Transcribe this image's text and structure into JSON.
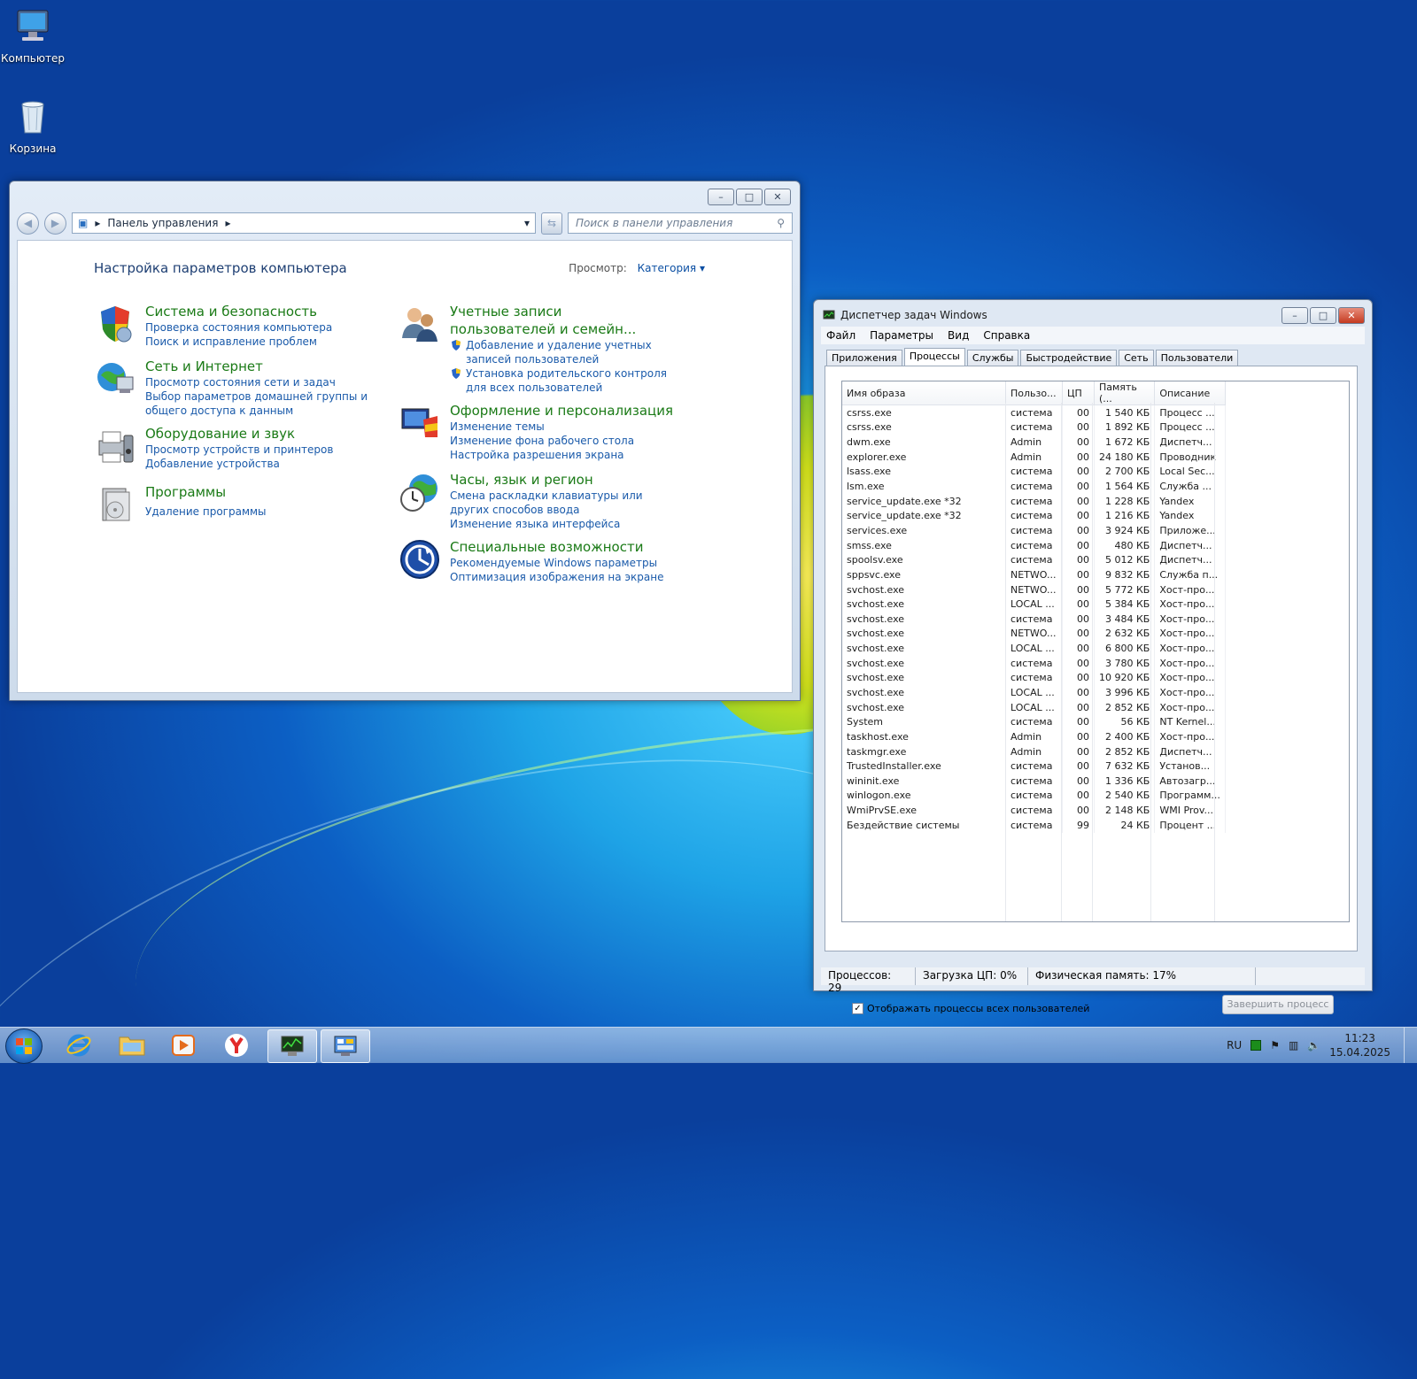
{
  "desktop": {
    "icons": [
      {
        "label": "Компьютер",
        "icon": "computer-icon"
      },
      {
        "label": "Корзина",
        "icon": "recycle-bin-icon"
      }
    ]
  },
  "control_panel": {
    "breadcrumb": "Панель управления",
    "search_placeholder": "Поиск в панели управления",
    "heading": "Настройка параметров компьютера",
    "view_label": "Просмотр:",
    "view_value": "Категория",
    "categories": [
      {
        "title": "Система и безопасность",
        "icon": "shield-icon",
        "links": [
          "Проверка состояния компьютера",
          "Поиск и исправление проблем"
        ]
      },
      {
        "title": "Сеть и Интернет",
        "icon": "network-icon",
        "links": [
          "Просмотр состояния сети и задач",
          "Выбор параметров домашней группы и общего доступа к данным"
        ]
      },
      {
        "title": "Оборудование и звук",
        "icon": "printer-icon",
        "links": [
          "Просмотр устройств и принтеров",
          "Добавление устройства"
        ]
      },
      {
        "title": "Программы",
        "icon": "programs-icon",
        "links": [
          "Удаление программы"
        ]
      },
      {
        "title": "Учетные записи пользователей и семейн...",
        "icon": "users-icon",
        "links": [
          "Добавление и удаление учетных записей пользователей",
          "Установка родительского контроля для всех пользователей"
        ]
      },
      {
        "title": "Оформление и персонализация",
        "icon": "appearance-icon",
        "links": [
          "Изменение темы",
          "Изменение фона рабочего стола",
          "Настройка разрешения экрана"
        ]
      },
      {
        "title": "Часы, язык и регион",
        "icon": "clock-globe-icon",
        "links": [
          "Смена раскладки клавиатуры или других способов ввода",
          "Изменение языка интерфейса"
        ]
      },
      {
        "title": "Специальные возможности",
        "icon": "accessibility-icon",
        "links": [
          "Рекомендуемые Windows параметры",
          "Оптимизация изображения на экране"
        ]
      }
    ]
  },
  "task_manager": {
    "title": "Диспетчер задач Windows",
    "menu": [
      "Файл",
      "Параметры",
      "Вид",
      "Справка"
    ],
    "tabs": [
      "Приложения",
      "Процессы",
      "Службы",
      "Быстродействие",
      "Сеть",
      "Пользователи"
    ],
    "active_tab": "Процессы",
    "columns": [
      "Имя образа",
      "Пользо...",
      "ЦП",
      "Память (...",
      "Описание"
    ],
    "rows": [
      [
        "csrss.exe",
        "система",
        "00",
        "1 540 КБ",
        "Процесс ..."
      ],
      [
        "csrss.exe",
        "система",
        "00",
        "1 892 КБ",
        "Процесс ..."
      ],
      [
        "dwm.exe",
        "Admin",
        "00",
        "1 672 КБ",
        "Диспетч..."
      ],
      [
        "explorer.exe",
        "Admin",
        "00",
        "24 180 КБ",
        "Проводник"
      ],
      [
        "lsass.exe",
        "система",
        "00",
        "2 700 КБ",
        "Local Sec..."
      ],
      [
        "lsm.exe",
        "система",
        "00",
        "1 564 КБ",
        "Служба ..."
      ],
      [
        "service_update.exe *32",
        "система",
        "00",
        "1 228 КБ",
        "Yandex"
      ],
      [
        "service_update.exe *32",
        "система",
        "00",
        "1 216 КБ",
        "Yandex"
      ],
      [
        "services.exe",
        "система",
        "00",
        "3 924 КБ",
        "Приложе..."
      ],
      [
        "smss.exe",
        "система",
        "00",
        "480 КБ",
        "Диспетч..."
      ],
      [
        "spoolsv.exe",
        "система",
        "00",
        "5 012 КБ",
        "Диспетч..."
      ],
      [
        "sppsvc.exe",
        "NETWO...",
        "00",
        "9 832 КБ",
        "Служба п..."
      ],
      [
        "svchost.exe",
        "NETWO...",
        "00",
        "5 772 КБ",
        "Хост-про..."
      ],
      [
        "svchost.exe",
        "LOCAL ...",
        "00",
        "5 384 КБ",
        "Хост-про..."
      ],
      [
        "svchost.exe",
        "система",
        "00",
        "3 484 КБ",
        "Хост-про..."
      ],
      [
        "svchost.exe",
        "NETWO...",
        "00",
        "2 632 КБ",
        "Хост-про..."
      ],
      [
        "svchost.exe",
        "LOCAL ...",
        "00",
        "6 800 КБ",
        "Хост-про..."
      ],
      [
        "svchost.exe",
        "система",
        "00",
        "3 780 КБ",
        "Хост-про..."
      ],
      [
        "svchost.exe",
        "система",
        "00",
        "10 920 КБ",
        "Хост-про..."
      ],
      [
        "svchost.exe",
        "LOCAL ...",
        "00",
        "3 996 КБ",
        "Хост-про..."
      ],
      [
        "svchost.exe",
        "LOCAL ...",
        "00",
        "2 852 КБ",
        "Хост-про..."
      ],
      [
        "System",
        "система",
        "00",
        "56 КБ",
        "NT Kernel..."
      ],
      [
        "taskhost.exe",
        "Admin",
        "00",
        "2 400 КБ",
        "Хост-про..."
      ],
      [
        "taskmgr.exe",
        "Admin",
        "00",
        "2 852 КБ",
        "Диспетч..."
      ],
      [
        "TrustedInstaller.exe",
        "система",
        "00",
        "7 632 КБ",
        "Установ..."
      ],
      [
        "wininit.exe",
        "система",
        "00",
        "1 336 КБ",
        "Автозагр..."
      ],
      [
        "winlogon.exe",
        "система",
        "00",
        "2 540 КБ",
        "Программ..."
      ],
      [
        "WmiPrvSE.exe",
        "система",
        "00",
        "2 148 КБ",
        "WMI Prov..."
      ],
      [
        "Бездействие системы",
        "система",
        "99",
        "24 КБ",
        "Процент ..."
      ]
    ],
    "show_all_label": "Отображать процессы всех пользователей",
    "show_all_checked": "✓",
    "end_process_label": "Завершить процесс",
    "status": {
      "processes": "Процессов: 29",
      "cpu": "Загрузка ЦП: 0%",
      "memory": "Физическая память: 17%"
    }
  },
  "taskbar": {
    "apps": [
      "internet-explorer-icon",
      "explorer-folder-icon",
      "media-player-icon",
      "yandex-browser-icon",
      "task-manager-icon",
      "control-panel-icon"
    ],
    "language": "RU",
    "time": "11:23",
    "date": "15.04.2025"
  }
}
